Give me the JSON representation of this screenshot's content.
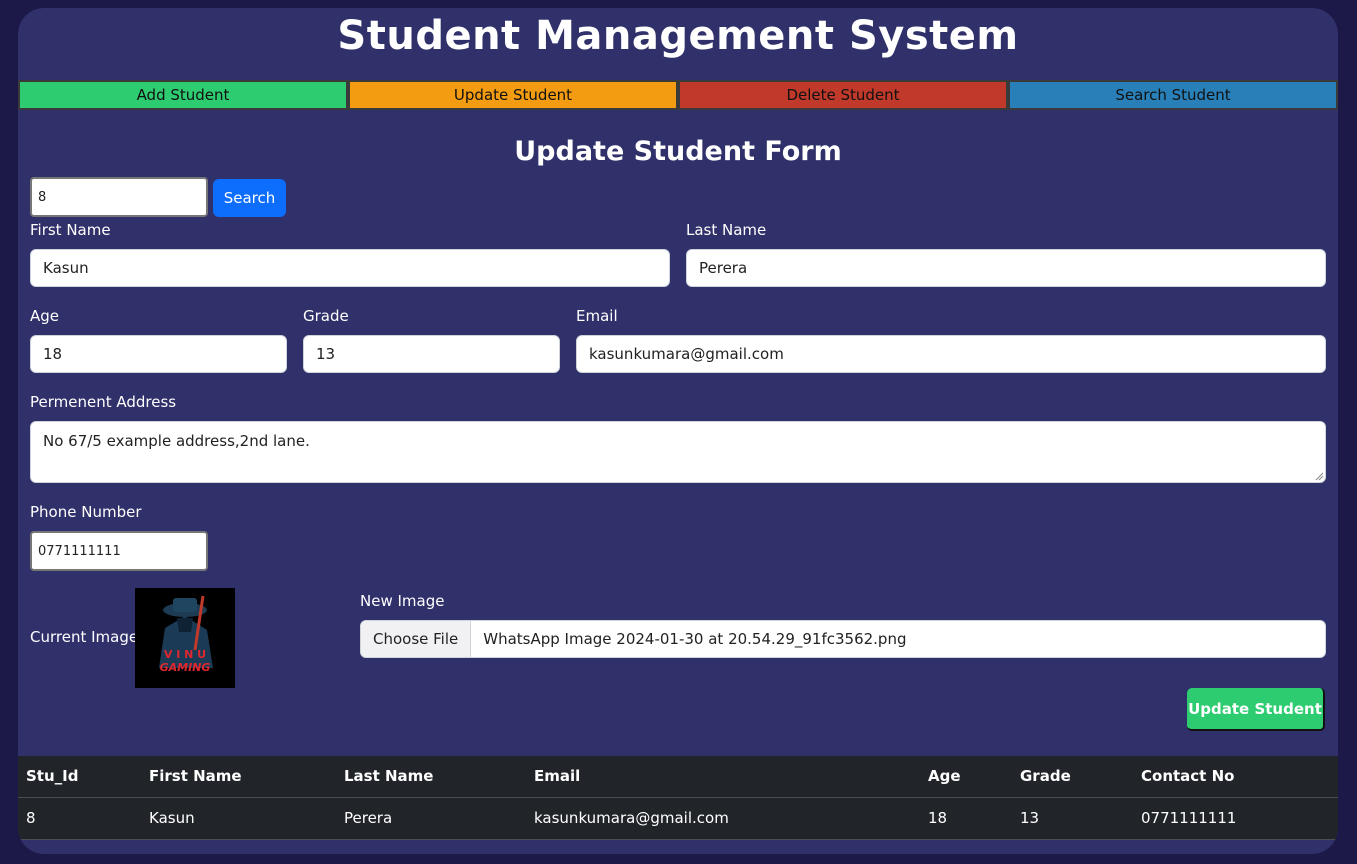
{
  "app": {
    "title": "Student Management System"
  },
  "nav": [
    {
      "label": "Add Student",
      "color": "#2ecc71"
    },
    {
      "label": "Update Student",
      "color": "#f39c12"
    },
    {
      "label": "Delete Student",
      "color": "#c0392b"
    },
    {
      "label": "Search Student",
      "color": "#2980b9"
    }
  ],
  "form": {
    "title": "Update Student Form",
    "search": {
      "value": "8",
      "button": "Search"
    },
    "first_name": {
      "label": "First Name",
      "value": "Kasun"
    },
    "last_name": {
      "label": "Last Name",
      "value": "Perera"
    },
    "age": {
      "label": "Age",
      "value": "18"
    },
    "grade": {
      "label": "Grade",
      "value": "13"
    },
    "email": {
      "label": "Email",
      "value": "kasunkumara@gmail.com"
    },
    "address": {
      "label": "Permenent Address",
      "value": "No 67/5 example address,2nd lane."
    },
    "phone": {
      "label": "Phone Number",
      "value": "0771111111"
    },
    "current_image": {
      "label": "Current Image",
      "logo_text": "V I N U GAMING"
    },
    "new_image": {
      "label": "New Image",
      "button": "Choose File",
      "file_name": "WhatsApp Image 2024-01-30 at 20.54.29_91fc3562.png"
    },
    "submit": "Update Student"
  },
  "table": {
    "headers": [
      "Stu_Id",
      "First Name",
      "Last Name",
      "Email",
      "Age",
      "Grade",
      "Contact No"
    ],
    "rows": [
      [
        "8",
        "Kasun",
        "Perera",
        "kasunkumara@gmail.com",
        "18",
        "13",
        "0771111111"
      ]
    ]
  }
}
